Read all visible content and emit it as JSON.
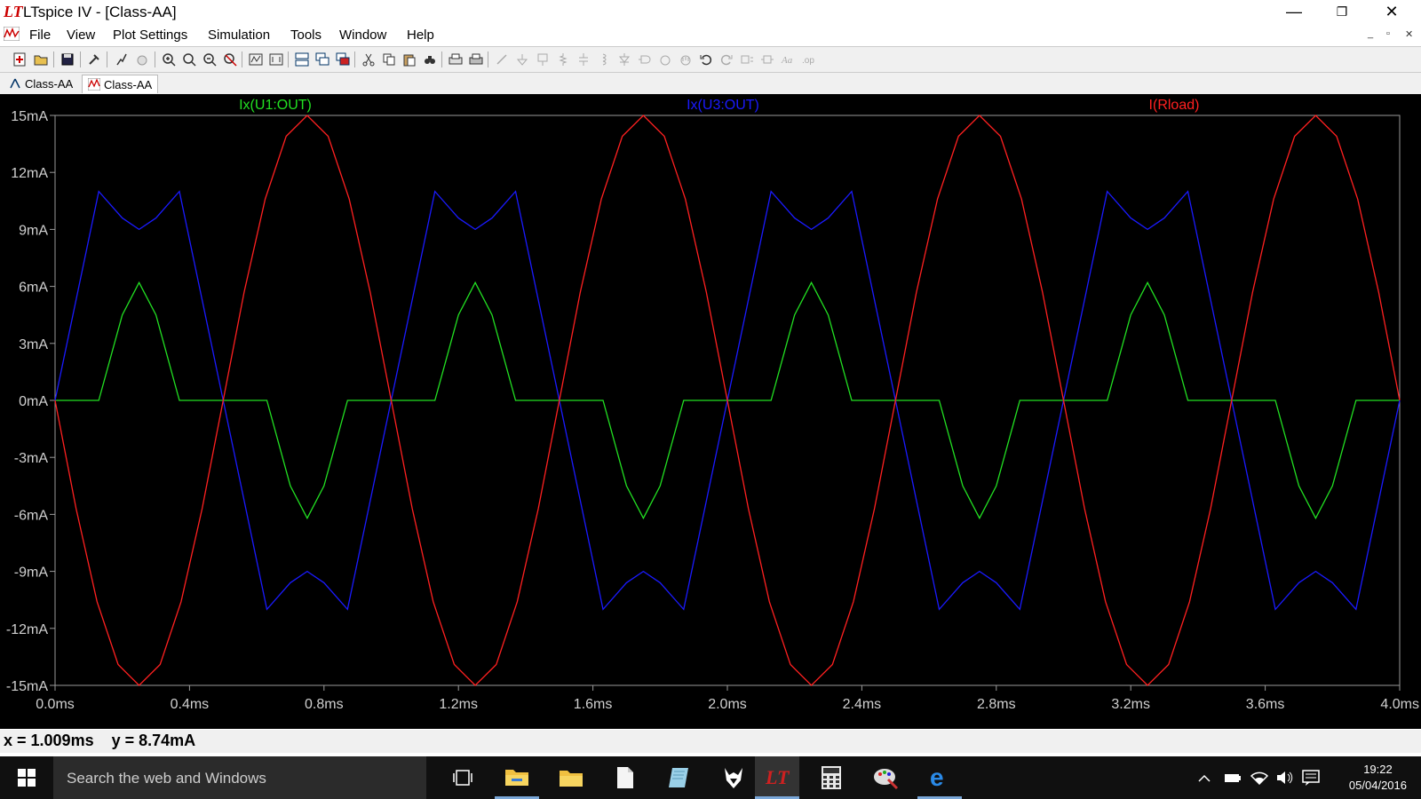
{
  "window": {
    "logo": "LT",
    "title": "LTspice IV - [Class-AA]",
    "minimize": "—",
    "restore": "❐",
    "close": "✕"
  },
  "menu": {
    "items": [
      "File",
      "View",
      "Plot Settings",
      "Simulation",
      "Tools",
      "Window",
      "Help"
    ],
    "mdi_minimize": "_",
    "mdi_restore": "▫",
    "mdi_close": "✕"
  },
  "tabs": [
    {
      "label": "Class-AA",
      "icon": "schematic-icon",
      "active": false
    },
    {
      "label": "Class-AA",
      "icon": "waveform-icon",
      "active": true
    }
  ],
  "plot": {
    "traces": [
      {
        "label": "Ix(U1:OUT)",
        "color": "#22e022"
      },
      {
        "label": "Ix(U3:OUT)",
        "color": "#1a1aff"
      },
      {
        "label": "I(Rload)",
        "color": "#ff2020"
      }
    ],
    "y_ticks": [
      "15mA",
      "12mA",
      "9mA",
      "6mA",
      "3mA",
      "0mA",
      "-3mA",
      "-6mA",
      "-9mA",
      "-12mA",
      "-15mA"
    ],
    "x_ticks": [
      "0.0ms",
      "0.4ms",
      "0.8ms",
      "1.2ms",
      "1.6ms",
      "2.0ms",
      "2.4ms",
      "2.8ms",
      "3.2ms",
      "3.6ms",
      "4.0ms"
    ]
  },
  "chart_data": {
    "type": "line",
    "xlim": [
      0,
      4.0
    ],
    "ylim": [
      -15,
      15
    ],
    "xunit": "ms",
    "yunit": "mA",
    "background": "#000000",
    "series": [
      {
        "name": "Ix(U1:OUT)",
        "color": "#22e022",
        "x": [
          0,
          0.13,
          0.2,
          0.25,
          0.3,
          0.37,
          0.5,
          0.63,
          0.7,
          0.75,
          0.8,
          0.87,
          1.0,
          1.13,
          1.2,
          1.25,
          1.3,
          1.37,
          1.5,
          1.63,
          1.7,
          1.75,
          1.8,
          1.87,
          2.0,
          2.13,
          2.2,
          2.25,
          2.3,
          2.37,
          2.5,
          2.63,
          2.7,
          2.75,
          2.8,
          2.87,
          3.0,
          3.13,
          3.2,
          3.25,
          3.3,
          3.37,
          3.5,
          3.63,
          3.7,
          3.75,
          3.8,
          3.87,
          4.0
        ],
        "y": [
          0,
          0,
          4.5,
          6.2,
          4.5,
          0,
          0,
          0,
          -4.5,
          -6.2,
          -4.5,
          0,
          0,
          0,
          4.5,
          6.2,
          4.5,
          0,
          0,
          0,
          -4.5,
          -6.2,
          -4.5,
          0,
          0,
          0,
          4.5,
          6.2,
          4.5,
          0,
          0,
          0,
          -4.5,
          -6.2,
          -4.5,
          0,
          0,
          0,
          4.5,
          6.2,
          4.5,
          0,
          0,
          0,
          -4.5,
          -6.2,
          -4.5,
          0,
          0
        ]
      },
      {
        "name": "Ix(U3:OUT)",
        "color": "#1a1aff",
        "x": [
          0,
          0.13,
          0.2,
          0.25,
          0.3,
          0.37,
          0.5,
          0.63,
          0.7,
          0.75,
          0.8,
          0.87,
          1.0,
          1.13,
          1.2,
          1.25,
          1.3,
          1.37,
          1.5,
          1.63,
          1.7,
          1.75,
          1.8,
          1.87,
          2.0,
          2.13,
          2.2,
          2.25,
          2.3,
          2.37,
          2.5,
          2.63,
          2.7,
          2.75,
          2.8,
          2.87,
          3.0,
          3.13,
          3.2,
          3.25,
          3.3,
          3.37,
          3.5,
          3.63,
          3.7,
          3.75,
          3.8,
          3.87,
          4.0
        ],
        "y": [
          0,
          11,
          9.6,
          9,
          9.6,
          11,
          0,
          -11,
          -9.6,
          -9,
          -9.6,
          -11,
          0,
          11,
          9.6,
          9,
          9.6,
          11,
          0,
          -11,
          -9.6,
          -9,
          -9.6,
          -11,
          0,
          11,
          9.6,
          9,
          9.6,
          11,
          0,
          -11,
          -9.6,
          -9,
          -9.6,
          -11,
          0,
          11,
          9.6,
          9,
          9.6,
          11,
          0,
          -11,
          -9.6,
          -9,
          -9.6,
          -11,
          0
        ]
      },
      {
        "name": "I(Rload)",
        "color": "#ff2020",
        "x": [
          0,
          0.0625,
          0.125,
          0.1875,
          0.25,
          0.3125,
          0.375,
          0.4375,
          0.5,
          0.5625,
          0.625,
          0.6875,
          0.75,
          0.8125,
          0.875,
          0.9375,
          1.0,
          1.0625,
          1.125,
          1.1875,
          1.25,
          1.3125,
          1.375,
          1.4375,
          1.5,
          1.5625,
          1.625,
          1.6875,
          1.75,
          1.8125,
          1.875,
          1.9375,
          2.0,
          2.0625,
          2.125,
          2.1875,
          2.25,
          2.3125,
          2.375,
          2.4375,
          2.5,
          2.5625,
          2.625,
          2.6875,
          2.75,
          2.8125,
          2.875,
          2.9375,
          3.0,
          3.0625,
          3.125,
          3.1875,
          3.25,
          3.3125,
          3.375,
          3.4375,
          3.5,
          3.5625,
          3.625,
          3.6875,
          3.75,
          3.8125,
          3.875,
          3.9375,
          4.0
        ],
        "y": [
          0,
          -5.7,
          -10.6,
          -13.9,
          -15,
          -13.9,
          -10.6,
          -5.7,
          0,
          5.7,
          10.6,
          13.9,
          15,
          13.9,
          10.6,
          5.7,
          0,
          -5.7,
          -10.6,
          -13.9,
          -15,
          -13.9,
          -10.6,
          -5.7,
          0,
          5.7,
          10.6,
          13.9,
          15,
          13.9,
          10.6,
          5.7,
          0,
          -5.7,
          -10.6,
          -13.9,
          -15,
          -13.9,
          -10.6,
          -5.7,
          0,
          5.7,
          10.6,
          13.9,
          15,
          13.9,
          10.6,
          5.7,
          0,
          -5.7,
          -10.6,
          -13.9,
          -15,
          -13.9,
          -10.6,
          -5.7,
          0,
          5.7,
          10.6,
          13.9,
          15,
          13.9,
          10.6,
          5.7,
          0
        ]
      }
    ]
  },
  "status": {
    "cursor": "x = 1.009ms    y = 8.74mA"
  },
  "taskbar": {
    "search_placeholder": "Search the web and Windows",
    "clock_time": "19:22",
    "clock_date": "05/04/2016"
  }
}
